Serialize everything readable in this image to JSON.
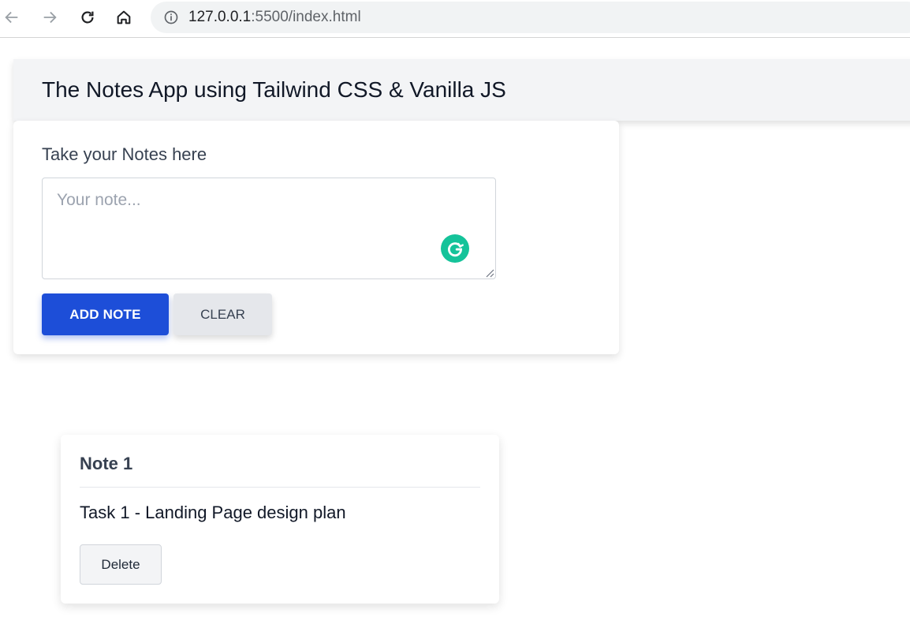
{
  "browser": {
    "url_host": "127.0.0.1",
    "url_rest": ":5500/index.html",
    "icons": [
      "back-arrow-icon",
      "forward-arrow-icon",
      "reload-icon",
      "home-icon",
      "info-icon"
    ]
  },
  "header": {
    "title": "The Notes App using Tailwind CSS & Vanilla JS"
  },
  "input_card": {
    "label": "Take your Notes here",
    "note_input": {
      "value": "",
      "placeholder": "Your note..."
    },
    "add_label": "ADD NOTE",
    "clear_label": "CLEAR",
    "grammarly_icon": "grammarly-icon"
  },
  "notes": [
    {
      "title": "Note 1",
      "text": "Task 1 - Landing Page design plan",
      "delete_label": "Delete"
    }
  ],
  "colors": {
    "primary": "#1d4ed8",
    "header_bg": "#f3f4f6",
    "clear_bg": "#e5e7eb",
    "grammarly": "#15c39a"
  }
}
